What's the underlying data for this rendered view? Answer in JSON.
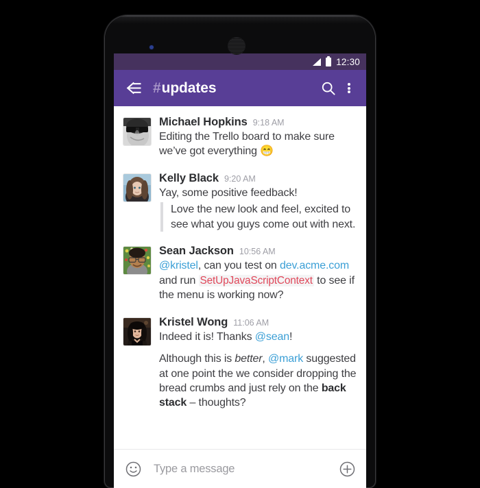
{
  "status_bar": {
    "time": "12:30",
    "signal_icon": "signal-bars-icon",
    "battery_icon": "battery-full-icon"
  },
  "app_bar": {
    "back_icon": "back-arrow-icon",
    "hash_prefix": "#",
    "channel_name": "updates",
    "search_icon": "search-icon",
    "overflow_icon": "overflow-menu-icon"
  },
  "messages": [
    {
      "author": "Michael Hopkins",
      "time": "9:18 AM",
      "avatar": "avatar-michael-hopkins",
      "text_before": "Editing the Trello board to make sure we’ve got everything ",
      "emoji": "😁"
    },
    {
      "author": "Kelly Black",
      "time": "9:20 AM",
      "avatar": "avatar-kelly-black",
      "text": "Yay, some positive feedback!",
      "quote": "Love the new look and feel, excited to see what you guys come out with next."
    },
    {
      "author": "Sean Jackson",
      "time": "10:56 AM",
      "avatar": "avatar-sean-jackson",
      "mention": "@kristel",
      "seg1": ", can you test on ",
      "link": "dev.acme.com",
      "seg2": " and run ",
      "code": "SetUpJavaScriptContext",
      "seg3": " to see if the menu is working now?"
    },
    {
      "author": "Kristel Wong",
      "time": "11:06 AM",
      "avatar": "avatar-kristel-wong",
      "line1_seg1": "Indeed it is! Thanks ",
      "line1_mention": "@sean",
      "line1_seg2": "!",
      "line2_seg1": "Although this is ",
      "line2_italic": "better",
      "line2_seg2": ", ",
      "line2_mention": "@mark",
      "line2_seg3": " suggested at one point the we consider dropping the bread crumbs and just rely on the ",
      "line2_bold": "back stack",
      "line2_seg4": " – thoughts?"
    }
  ],
  "input_bar": {
    "emoji_icon": "emoji-smiley-icon",
    "placeholder": "Type a message",
    "value": "",
    "attach_icon": "plus-circle-icon"
  },
  "colors": {
    "status_bar": "#46325e",
    "app_bar": "#583e96",
    "mention": "#3b9fd6",
    "link": "#3b9fd6",
    "code": "#e0485a",
    "quote_bar": "#dcdcdf"
  }
}
